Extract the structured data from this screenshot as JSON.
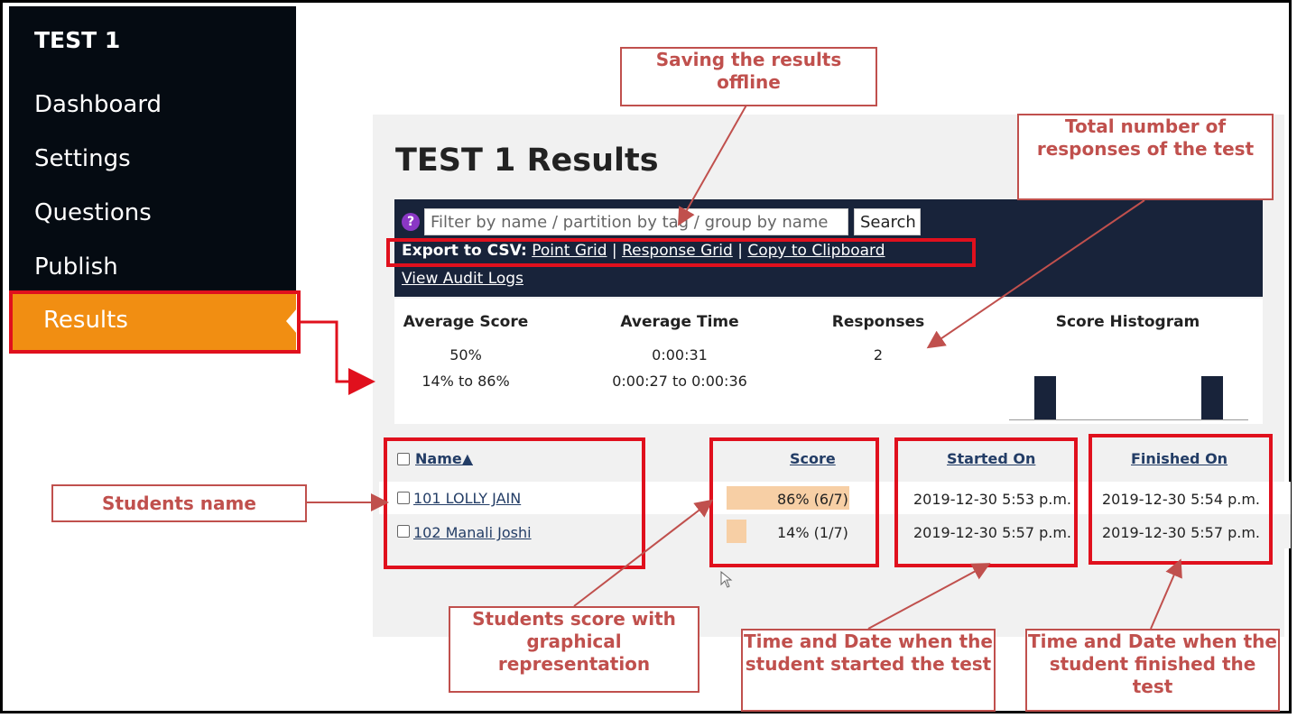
{
  "sidebar": {
    "title": "TEST 1",
    "items": [
      {
        "label": "Dashboard"
      },
      {
        "label": "Settings"
      },
      {
        "label": "Questions"
      },
      {
        "label": "Publish"
      },
      {
        "label": "Results"
      }
    ],
    "active_color": "#f18e12"
  },
  "results": {
    "title": "TEST 1 Results",
    "search": {
      "placeholder": "Filter by name / partition by tag / group by name",
      "button": "Search"
    },
    "export": {
      "label": "Export to CSV:",
      "links": [
        "Point Grid",
        "Response Grid",
        "Copy to Clipboard"
      ],
      "separator": "|"
    },
    "audit_link": "View Audit Logs",
    "stats": {
      "average_score": {
        "heading": "Average Score",
        "value": "50%",
        "range": "14% to 86%"
      },
      "average_time": {
        "heading": "Average Time",
        "value": "0:00:31",
        "range": "0:00:27 to 0:00:36"
      },
      "responses": {
        "heading": "Responses",
        "value": "2"
      },
      "histogram": {
        "heading": "Score Histogram",
        "bins": [
          0,
          1,
          0,
          0,
          0,
          0,
          0,
          0,
          1,
          0
        ]
      }
    },
    "table": {
      "headers": {
        "name": "Name▲",
        "score": "Score",
        "started": "Started On",
        "finished": "Finished On"
      },
      "rows": [
        {
          "name": "101 LOLLY JAIN",
          "score": "86% (6/7)",
          "score_fraction": 0.86,
          "started": "2019-12-30 5:53 p.m.",
          "finished": "2019-12-30 5:54 p.m."
        },
        {
          "name": "102 Manali Joshi",
          "score": "14% (1/7)",
          "score_fraction": 0.14,
          "started": "2019-12-30 5:57 p.m.",
          "finished": "2019-12-30 5:57 p.m."
        }
      ]
    }
  },
  "annotations": {
    "saving": "Saving the results offline",
    "total": "Total number of responses of the test",
    "students_name": "Students name",
    "score": "Students score with graphical representation",
    "started": "Time and Date when the student started the test",
    "finished": "Time and Date when the student finished the test",
    "color": "#c0504d",
    "highlight_color": "#e0101d"
  }
}
